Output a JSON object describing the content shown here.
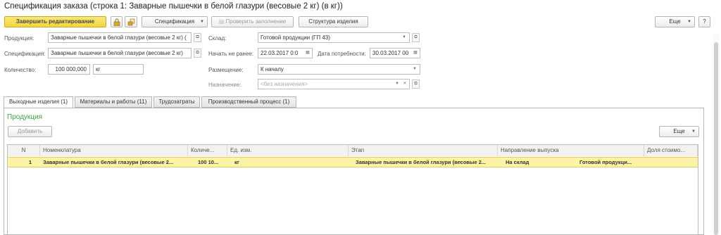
{
  "window": {
    "title": "Спецификация заказа (строка 1: Заварные пышечки в белой глазури (весовые 2 кг) (в кг))"
  },
  "toolbar": {
    "finish_edit": "Завершить редактирование",
    "specification": "Спецификация",
    "check_fill": "Проверить заполнение",
    "product_structure": "Структура изделия",
    "more": "Еще",
    "help": "?"
  },
  "form": {
    "product_label": "Продукция:",
    "product_value": "Заварные пышечки в белой глазури (весовые 2 кг) (",
    "spec_label": "Спецификация:",
    "spec_value": "Заварные пышечки в белой глазури (весовые 2 кг)",
    "qty_label": "Количество:",
    "qty_value": "100 000,000",
    "unit_value": "кг",
    "warehouse_label": "Склад:",
    "warehouse_value": "Готовой продукции (ГП 43)",
    "start_label": "Начать не ранее:",
    "start_value": "22.03.2017 0:0",
    "need_date_label": "Дата потребности:",
    "need_date_value": "30.03.2017 00",
    "placement_label": "Размещение:",
    "placement_value": "К началу",
    "purpose_label": "Назначение:",
    "purpose_placeholder": "<без назначения>"
  },
  "tabs": [
    {
      "label": "Выходные изделия (1)"
    },
    {
      "label": "Материалы и работы (11)"
    },
    {
      "label": "Трудозатраты"
    },
    {
      "label": "Производственный процесс (1)"
    }
  ],
  "section": {
    "title": "Продукция",
    "add": "Добавить",
    "more": "Еще"
  },
  "table": {
    "headers": [
      "N",
      "Номенклатура",
      "Количе...",
      "Ед. изм.",
      "Этап",
      "Направление выпуска",
      "Доля стоимо..."
    ],
    "rows": [
      {
        "n": "1",
        "nomenclature": "Заварные пышечки в белой глазури (весовые 2...",
        "qty": "100 10...",
        "unit": "кг",
        "stage": "Заварные пышечки в белой глазури (весовые 2...",
        "direction": "На склад",
        "direction_detail": "Готовой продукци...",
        "share": ""
      }
    ]
  },
  "colors": {
    "accent_yellow": "#f2d53a",
    "section_green": "#3f9f3f",
    "row_highlight": "#fdf3a6"
  },
  "icons": {
    "lock": "lock-icon",
    "copy_lock": "copy-lock-icon",
    "dropdown": "chevron-down-icon",
    "open": "open-icon",
    "calendar": "calendar-icon",
    "clear": "clear-icon"
  }
}
